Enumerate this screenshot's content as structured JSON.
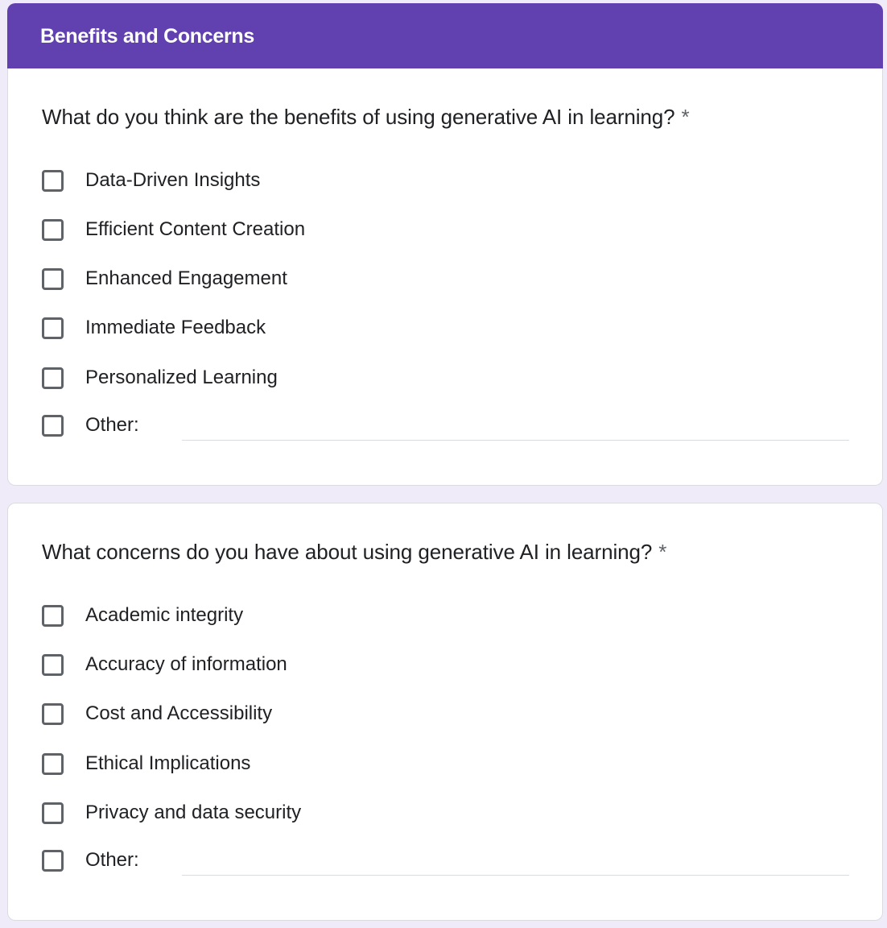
{
  "section": {
    "title": "Benefits and Concerns"
  },
  "questions": [
    {
      "text": "What do you think are the benefits of using generative AI in learning?",
      "required_mark": "*",
      "options": [
        "Data-Driven Insights",
        "Efficient Content Creation",
        "Enhanced Engagement",
        "Immediate Feedback",
        "Personalized Learning"
      ],
      "other_label": "Other:",
      "other_value": ""
    },
    {
      "text": "What concerns do you have about using generative AI in learning?",
      "required_mark": "*",
      "options": [
        "Academic integrity",
        "Accuracy of information",
        "Cost and Accessibility",
        "Ethical Implications",
        "Privacy and data security"
      ],
      "other_label": "Other:",
      "other_value": ""
    }
  ],
  "colors": {
    "header_bg": "#6140b0",
    "page_bg": "#efebf8",
    "checkbox_border": "#5f6368"
  }
}
